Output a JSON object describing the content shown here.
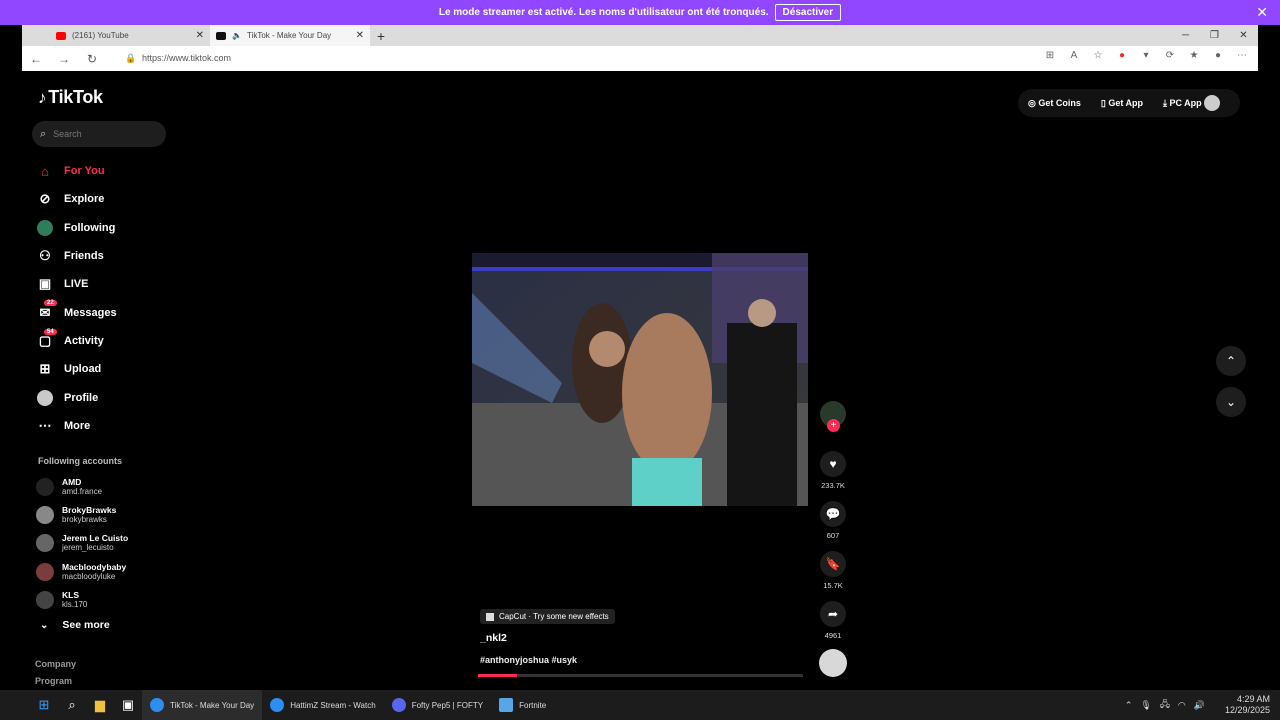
{
  "streamer": {
    "message": "Le mode streamer est activé. Les noms d'utilisateur ont été tronqués.",
    "button": "Désactiver"
  },
  "browser": {
    "tabs": [
      {
        "title": "(2161) YouTube",
        "color": "#ff0000"
      },
      {
        "title": "TikTok - Make Your Day",
        "color": "#000000"
      }
    ],
    "url": "https://www.tiktok.com"
  },
  "tiktok": {
    "logo": "TikTok",
    "search_placeholder": "Search",
    "nav": [
      {
        "label": "For You",
        "icon": "home-icon",
        "active": true
      },
      {
        "label": "Explore",
        "icon": "compass-icon"
      },
      {
        "label": "Following",
        "icon": "following-avatar-icon"
      },
      {
        "label": "Friends",
        "icon": "friends-icon"
      },
      {
        "label": "LIVE",
        "icon": "live-icon"
      },
      {
        "label": "Messages",
        "icon": "messages-icon",
        "badge": "22"
      },
      {
        "label": "Activity",
        "icon": "activity-icon",
        "badge": "54"
      },
      {
        "label": "Upload",
        "icon": "upload-icon"
      },
      {
        "label": "Profile",
        "icon": "profile-avatar-icon"
      },
      {
        "label": "More",
        "icon": "more-icon"
      }
    ],
    "following_title": "Following accounts",
    "following": [
      {
        "name": "AMD",
        "handle": "amd.france"
      },
      {
        "name": "BrokyBrawks",
        "handle": "brokybrawks"
      },
      {
        "name": "Jerem Le Cuisto",
        "handle": "jerem_lecuisto"
      },
      {
        "name": "Macbloodybaby",
        "handle": "macbloodyluke"
      },
      {
        "name": "KLS",
        "handle": "kls.170"
      }
    ],
    "see_more": "See more",
    "footer": [
      "Company",
      "Program"
    ],
    "top_right": {
      "coins": "Get Coins",
      "get_app": "Get App",
      "pc_app": "PC App"
    },
    "video": {
      "effect": "CapCut · Try some new effects",
      "author": "_nkl2",
      "tags": "#anthonyjoshua #usyk",
      "progress": 0.12,
      "likes": "233.7K",
      "comments": "607",
      "saves": "15.7K",
      "shares": "4961"
    }
  },
  "taskbar": {
    "apps": [
      {
        "label": "TikTok - Make Your Day",
        "color": "#2b8ef0"
      },
      {
        "label": "HattimZ Stream - Watch",
        "color": "#2b8ef0"
      },
      {
        "label": "Fofty Pep5 | FOFTY",
        "color": "#5865f2"
      },
      {
        "label": "Fortnite",
        "color": "#58a6e8"
      }
    ],
    "time": "4:29 AM",
    "date": "12/29/2025"
  },
  "colors": {
    "accent": "#fe2c55",
    "streamer_bar": "#9147ff"
  }
}
